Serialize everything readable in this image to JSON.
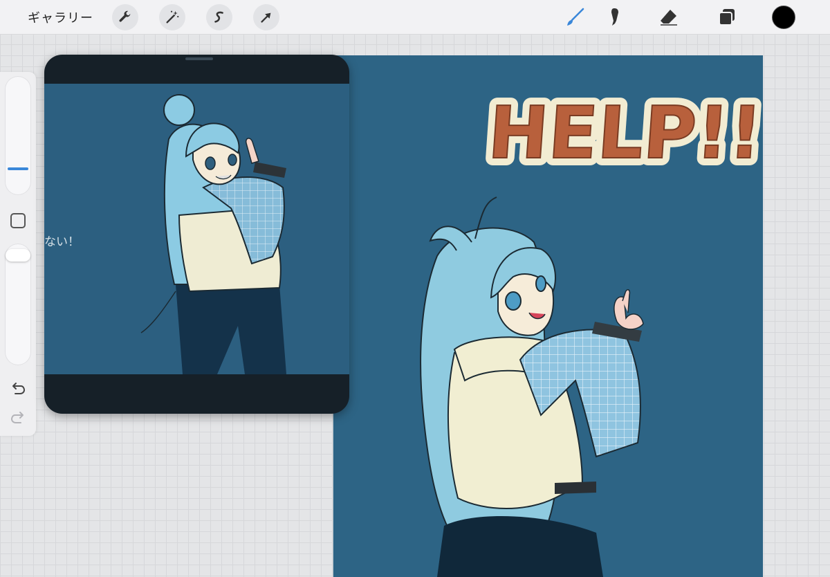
{
  "toolbar": {
    "gallery_label": "ギャラリー",
    "left_tools": [
      {
        "name": "actions",
        "icon": "wrench-icon"
      },
      {
        "name": "adjustments",
        "icon": "magic-wand-icon"
      },
      {
        "name": "selection",
        "icon": "selection-s-icon"
      },
      {
        "name": "transform",
        "icon": "arrow-cursor-icon"
      }
    ],
    "right_tools": [
      {
        "name": "brush",
        "icon": "brush-icon",
        "active": true
      },
      {
        "name": "smudge",
        "icon": "smudge-icon"
      },
      {
        "name": "eraser",
        "icon": "eraser-icon"
      },
      {
        "name": "layers",
        "icon": "layers-icon"
      }
    ],
    "current_color": "#000000",
    "active_color": "#3a87d9"
  },
  "sidebar": {
    "size_slider_icon": "slider-thumb-icon",
    "modify_icon": "square-outline-icon",
    "undo_icon": "undo-icon",
    "redo_icon": "redo-icon"
  },
  "canvas": {
    "background": "#2d6485",
    "title_text": "HELP!!",
    "title_color": "#b8603c",
    "title_outline": "#f2ecd2"
  },
  "reference": {
    "caption": "ない！",
    "background": "#2c5f80"
  }
}
